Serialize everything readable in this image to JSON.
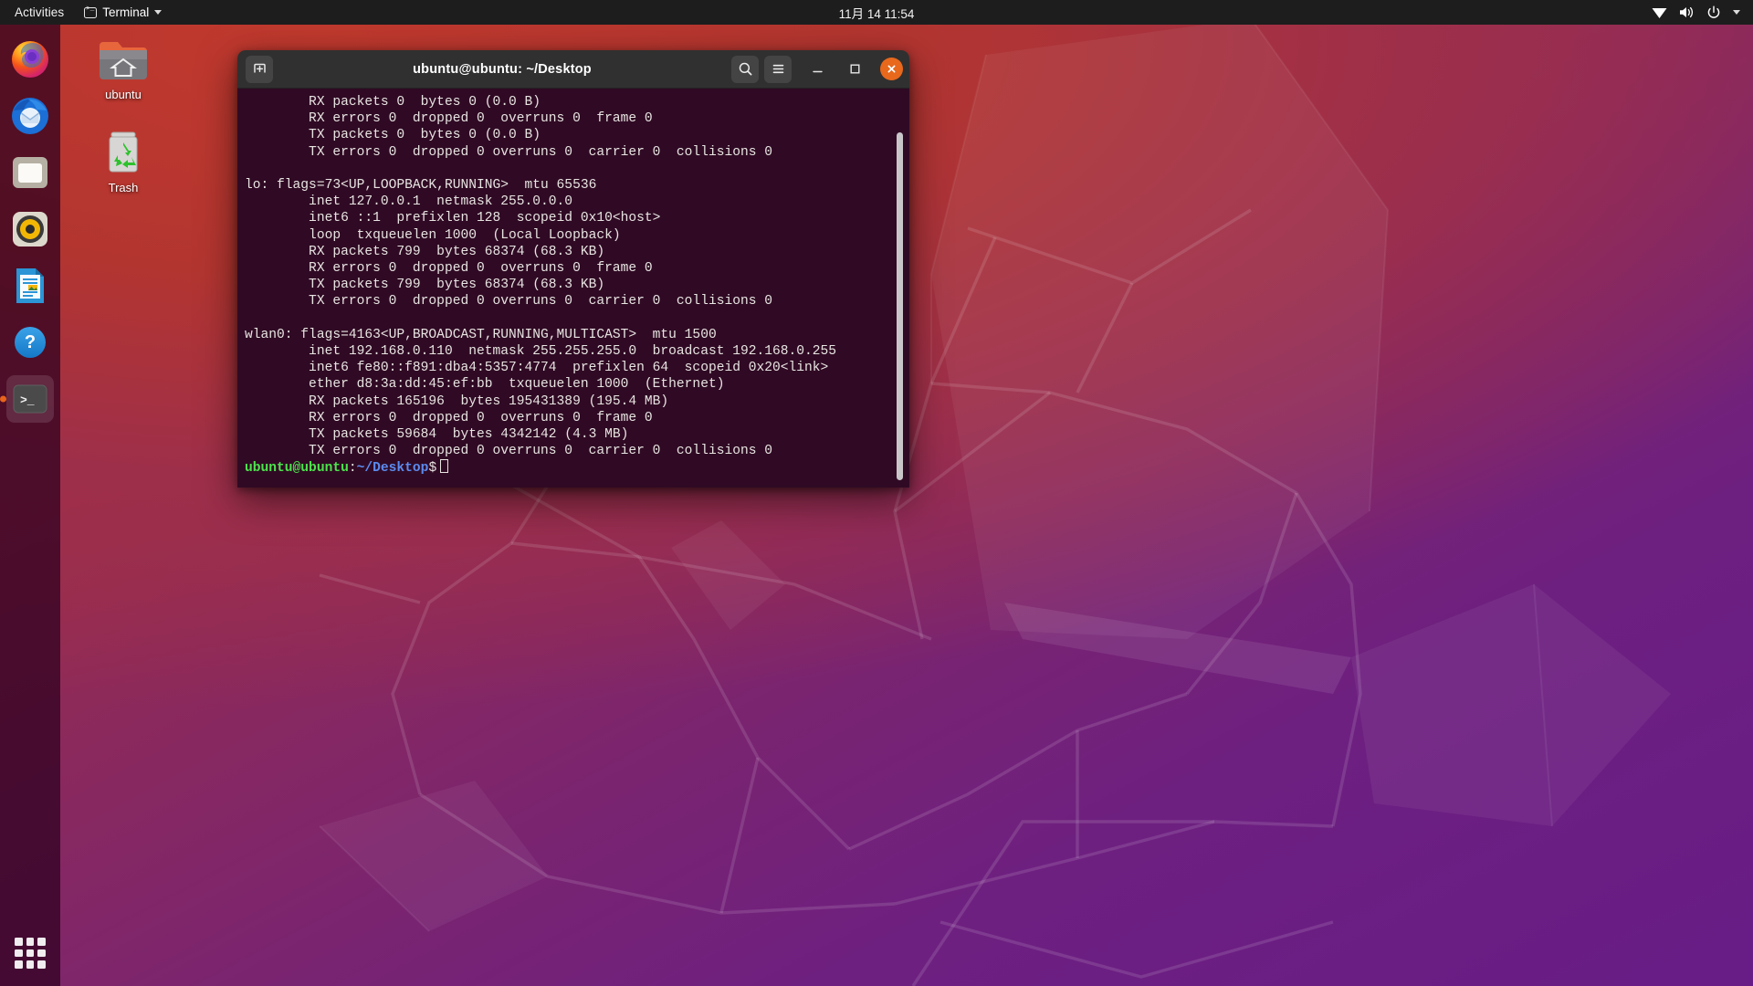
{
  "top_panel": {
    "activities_label": "Activities",
    "app_menu_label": "Terminal",
    "app_menu_icon": "terminal-icon",
    "clock": "11月 14 11:54",
    "tray_icons": [
      "wifi-icon",
      "volume-icon",
      "power-icon",
      "chevron-down-icon"
    ]
  },
  "dock": {
    "items": [
      {
        "name": "firefox",
        "label": "Firefox Web Browser",
        "running": false
      },
      {
        "name": "thunderbird",
        "label": "Thunderbird Mail",
        "running": false
      },
      {
        "name": "files",
        "label": "Files",
        "running": false
      },
      {
        "name": "rhythmbox",
        "label": "Rhythmbox",
        "running": false
      },
      {
        "name": "libreoffice",
        "label": "LibreOffice Writer",
        "running": false
      },
      {
        "name": "help",
        "label": "Help",
        "running": false
      },
      {
        "name": "terminal",
        "label": "Terminal",
        "running": true
      }
    ],
    "show_apps_label": "Show Applications"
  },
  "desktop_icons": [
    {
      "name": "home-folder",
      "label": "ubuntu"
    },
    {
      "name": "trash",
      "label": "Trash"
    }
  ],
  "terminal": {
    "title": "ubuntu@ubuntu: ~/Desktop",
    "new_tab_icon": "new-tab-icon",
    "search_icon": "search-icon",
    "menu_icon": "hamburger-menu-icon",
    "minimize_icon": "minimize-icon",
    "maximize_icon": "maximize-icon",
    "close_icon": "close-icon",
    "background_color": "#300a24",
    "foreground_color": "#e8e4e2",
    "output": "        RX packets 0  bytes 0 (0.0 B)\n        RX errors 0  dropped 0  overruns 0  frame 0\n        TX packets 0  bytes 0 (0.0 B)\n        TX errors 0  dropped 0 overruns 0  carrier 0  collisions 0\n\nlo: flags=73<UP,LOOPBACK,RUNNING>  mtu 65536\n        inet 127.0.0.1  netmask 255.0.0.0\n        inet6 ::1  prefixlen 128  scopeid 0x10<host>\n        loop  txqueuelen 1000  (Local Loopback)\n        RX packets 799  bytes 68374 (68.3 KB)\n        RX errors 0  dropped 0  overruns 0  frame 0\n        TX packets 799  bytes 68374 (68.3 KB)\n        TX errors 0  dropped 0 overruns 0  carrier 0  collisions 0\n\nwlan0: flags=4163<UP,BROADCAST,RUNNING,MULTICAST>  mtu 1500\n        inet 192.168.0.110  netmask 255.255.255.0  broadcast 192.168.0.255\n        inet6 fe80::f891:dba4:5357:4774  prefixlen 64  scopeid 0x20<link>\n        ether d8:3a:dd:45:ef:bb  txqueuelen 1000  (Ethernet)\n        RX packets 165196  bytes 195431389 (195.4 MB)\n        RX errors 0  dropped 0  overruns 0  frame 0\n        TX packets 59684  bytes 4342142 (4.3 MB)\n        TX errors 0  dropped 0 overruns 0  carrier 0  collisions 0\n",
    "prompt": {
      "user_host": "ubuntu@ubuntu",
      "separator": ":",
      "path": "~/Desktop",
      "symbol": "$",
      "input": ""
    }
  }
}
